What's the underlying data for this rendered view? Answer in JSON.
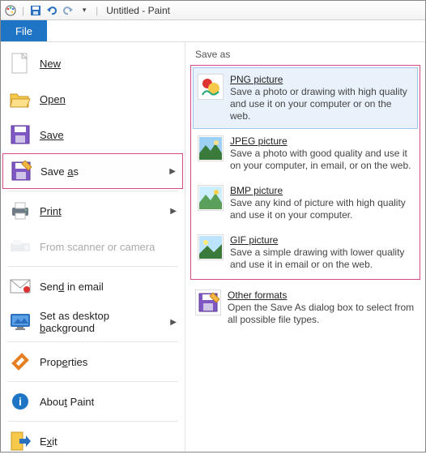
{
  "titlebar": {
    "app_title": "Untitled - Paint"
  },
  "file_tab": {
    "label": "File"
  },
  "menu": {
    "new": "New",
    "open": "Open",
    "save": "Save",
    "save_as_pre": "Save ",
    "save_as_u": "a",
    "save_as_post": "s",
    "print": "Print",
    "scanner": "From scanner or camera",
    "send_email": "Sen",
    "send_email_u": "d",
    "send_email_post": " in email",
    "desktop_bg": "Set as desktop ",
    "desktop_bg_u": "b",
    "desktop_bg_post": "ackground",
    "properties": "Prop",
    "properties_u": "e",
    "properties_post": "rties",
    "about": "Abou",
    "about_u": "t",
    "about_post": " Paint",
    "exit": "E",
    "exit_u": "x",
    "exit_post": "it"
  },
  "right": {
    "section": "Save as",
    "formats": [
      {
        "title_u": "P",
        "title_rest": "NG picture",
        "desc": "Save a photo or drawing with high quality and use it on your computer or on the web."
      },
      {
        "title_u": "J",
        "title_rest": "PEG picture",
        "desc": "Save a photo with good quality and use it on your computer, in email, or on the web."
      },
      {
        "title_u": "B",
        "title_rest": "MP picture",
        "desc": "Save any kind of picture with high quality and use it on your computer."
      },
      {
        "title_u": "G",
        "title_rest": "IF picture",
        "desc": "Save a simple drawing with lower quality and use it in email or on the web."
      }
    ],
    "other": {
      "title_u": "O",
      "title_rest": "ther formats",
      "desc": "Open the Save As dialog box to select from all possible file types."
    }
  }
}
